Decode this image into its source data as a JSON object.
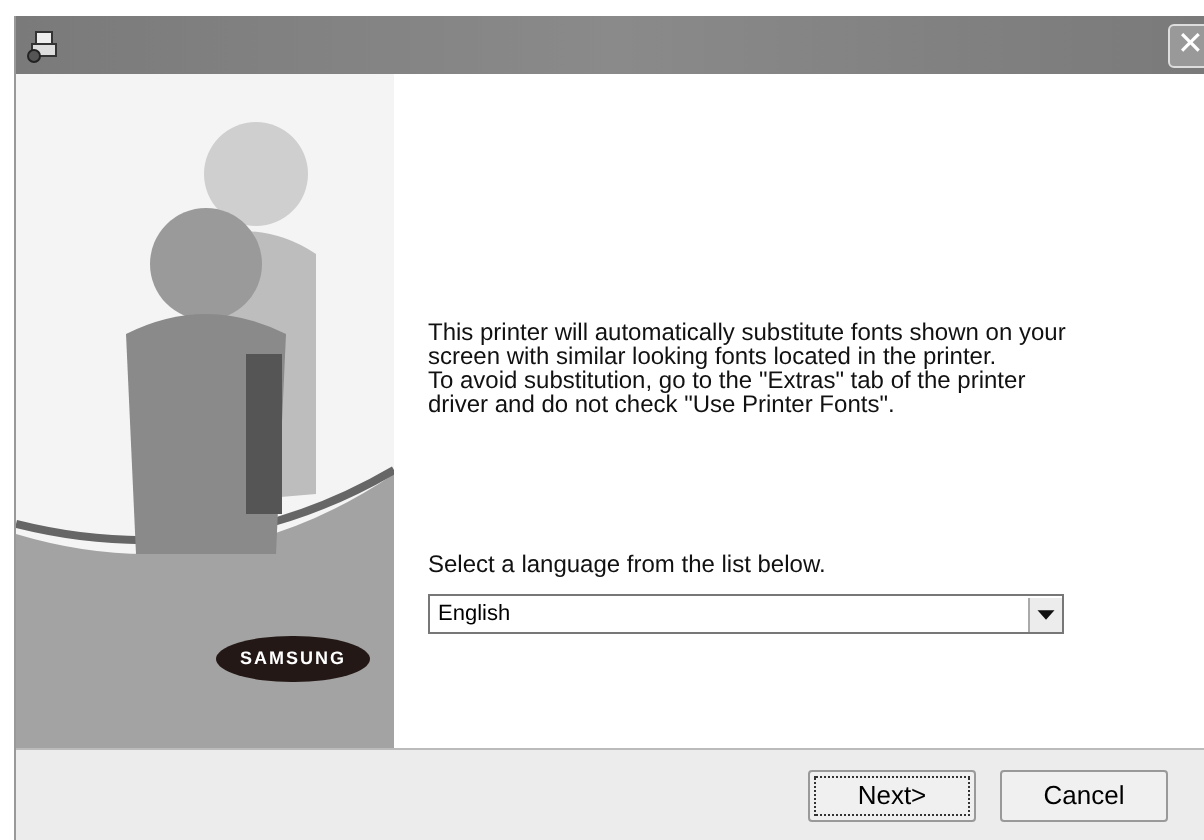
{
  "window": {
    "close_symbol": "✕"
  },
  "brand": {
    "logo_text": "SAMSUNG"
  },
  "message": "This printer will automatically substitute fonts shown on your\nscreen with similar looking fonts located in the printer.\nTo avoid substitution, go to the \"Extras\" tab of the printer\ndriver and do not check \"Use Printer Fonts\".",
  "language": {
    "label": "Select a language from the list below.",
    "value": "English"
  },
  "buttons": [
    {
      "label": "Next>",
      "focused": true
    },
    {
      "label": "Cancel",
      "focused": false
    }
  ]
}
